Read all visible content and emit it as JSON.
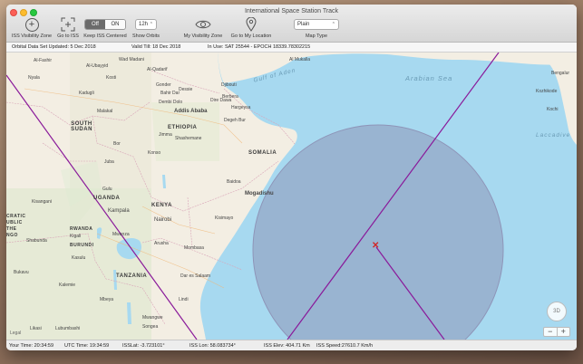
{
  "window": {
    "title": "International Space Station Track"
  },
  "toolbar": {
    "visibility_zone": "ISS Visibility Zone",
    "go_to_iss": "Go to ISS",
    "keep_centered": "Keep ISS Centered",
    "toggle_off": "Off",
    "toggle_on": "ON",
    "orbits_value": "12h",
    "show_orbits": "Show Orbits",
    "my_visibility_zone": "My Visibility Zone",
    "go_to_my_location": "Go to My Location",
    "map_type_value": "Plain",
    "map_type": "Map Type"
  },
  "info": {
    "updated": "Orbital Data Set Updated: 5 Dec 2018",
    "valid": "Valid Till: 18 Dec 2018",
    "in_use": "In Use: SAT 25544 - EPOCH 18339.78302215"
  },
  "map": {
    "countries": [
      "ETHIOPIA",
      "SOUTH SUDAN",
      "SOMALIA",
      "KENYA",
      "UGANDA",
      "RWANDA",
      "BURUNDI",
      "TANZANIA",
      "CRATIC\nUBLIC\nTHE\nNGO"
    ],
    "seas": [
      "Gulf of Aden",
      "Arabian Sea",
      "Laccadive"
    ],
    "cities": {
      "al_fashir": "Al-Fashir",
      "nyala": "Nyala",
      "al_ubayyid": "Al-Ubayyid",
      "wad_madani": "Wad Madani",
      "al_qadarif": "Al-Qadarif",
      "kosti": "Kosti",
      "kadugli": "Kadugli",
      "gonder": "Gonder",
      "bahir_dar": "Bahir Dar",
      "dessie": "Dessie",
      "dembi_dolo": "Dembi Dolo",
      "addis_ababa": "Addis Ababa",
      "dire_dawa": "Dire Dawa",
      "hargeysa": "Hargeysa",
      "djibouti": "Djibouti",
      "berbera": "Berbera",
      "degeh_bur": "Degeh Bur",
      "al_mukalla": "Al Mukalla",
      "malakal": "Malakal",
      "bor": "Bor",
      "juba": "Juba",
      "jimma": "Jimma",
      "shashemane": "Shashemane",
      "konso": "Konso",
      "baidoa": "Baidoa",
      "mogadishu": "Mogadishu",
      "kisimayo": "Kisimayo",
      "gulu": "Gulu",
      "kisangani": "Kisangani",
      "kampala": "Kampala",
      "nairobi": "Nairobi",
      "kigali": "Kigali",
      "mwanza": "Mwanza",
      "shabunda": "Shabunda",
      "kasulu": "Kasulu",
      "arusha": "Arusha",
      "mombasa": "Mombasa",
      "dar_es_salaam": "Dar es Salaam",
      "bukavu": "Bukavu",
      "kalemie": "Kalemie",
      "mbeya": "Mbeya",
      "likasi": "Likasi",
      "lubumbashi": "Lubumbashi",
      "bengaluru": "Bengalur",
      "kozhikode": "Kozhikode",
      "kochi": "Kochi",
      "mwangwe": "Mwangwe",
      "lindi": "Lindi",
      "songea": "Songea"
    },
    "marker": "✕",
    "zone_color": "#8e95b8",
    "track_color": "#8a1a9a"
  },
  "controls": {
    "compass": "3D",
    "zoom_out": "−",
    "zoom_in": "+",
    "legal": "Legal"
  },
  "status": {
    "your_time": "Your Time:  20:34:59",
    "utc_time": "UTC Time: 19:34:59",
    "iss_lat": "ISSLat: -3.723101°",
    "iss_lon": "ISS Lon: 58.083734°",
    "iss_elev": "ISS Elev: 404.71 Km",
    "iss_speed": "ISS Speed:27610.7 Km/h"
  }
}
